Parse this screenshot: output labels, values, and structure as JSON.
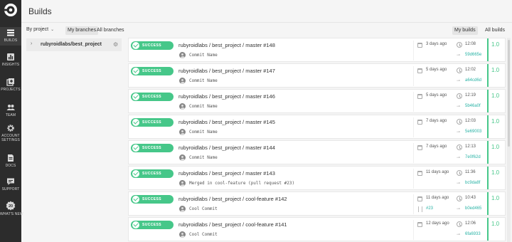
{
  "nav": {
    "logo": "circleci-logo",
    "items": [
      {
        "label": "BUILDS",
        "icon": "builds-icon"
      },
      {
        "label": "INSIGHTS",
        "icon": "insights-icon"
      },
      {
        "label": "PROJECTS",
        "icon": "projects-icon"
      },
      {
        "label": "TEAM",
        "icon": "team-icon"
      },
      {
        "label": "ACCOUNT",
        "label2": "SETTINGS",
        "icon": "gear-icon"
      },
      {
        "label": "DOCS",
        "icon": "docs-icon"
      },
      {
        "label": "SUPPORT",
        "icon": "support-icon"
      },
      {
        "label": "WHAT'S NEW",
        "icon": "whats-new-icon",
        "badge": "20"
      }
    ]
  },
  "header": {
    "title": "Builds"
  },
  "filters": {
    "by_project": "By project",
    "my_branches": "My branches",
    "all_branches": "All branches",
    "my_builds": "My builds",
    "all_builds": "All builds"
  },
  "project": {
    "name": "rubyroidlabs/best_project"
  },
  "colors": {
    "success": "#46c789",
    "link": "#2ab3a6",
    "nav_bg": "#2c2c2c"
  },
  "builds": [
    {
      "status": "SUCCESS",
      "title": "rubyroidlabs / best_project / master #148",
      "commit": "Commit Name",
      "ago": "3 days ago",
      "duration": "12:08",
      "sha": "59d665e",
      "version": "1.0",
      "pr": ""
    },
    {
      "status": "SUCCESS",
      "title": "rubyroidlabs / best_project / master #147",
      "commit": "Commit Name",
      "ago": "5 days ago",
      "duration": "12:02",
      "sha": "a64cd6d",
      "version": "1.0",
      "pr": ""
    },
    {
      "status": "SUCCESS",
      "title": "rubyroidlabs / best_project / master #146",
      "commit": "Commit Name",
      "ago": "5 days ago",
      "duration": "12:19",
      "sha": "5b46a0f",
      "version": "1.0",
      "pr": ""
    },
    {
      "status": "SUCCESS",
      "title": "rubyroidlabs / best_project / master #145",
      "commit": "Commit Name",
      "ago": "7 days ago",
      "duration": "12:03",
      "sha": "5e69003",
      "version": "1.0",
      "pr": ""
    },
    {
      "status": "SUCCESS",
      "title": "rubyroidlabs / best_project / master #144",
      "commit": "Commit Name",
      "ago": "7 days ago",
      "duration": "12:13",
      "sha": "7e0f62d",
      "version": "1.0",
      "pr": ""
    },
    {
      "status": "SUCCESS",
      "title": "rubyroidlabs / best_project / master #143",
      "commit": "Merged in cool-feature (pull request #23)",
      "ago": "11 days ago",
      "duration": "11:36",
      "sha": "bc9da8f",
      "version": "1.0",
      "pr": ""
    },
    {
      "status": "SUCCESS",
      "title": "rubyroidlabs / best_project / cool-feature #142",
      "commit": "Cool Commit",
      "ago": "11 days ago",
      "duration": "10:43",
      "sha": "b0ed465",
      "version": "1.0",
      "pr": "#23"
    },
    {
      "status": "SUCCESS",
      "title": "rubyroidlabs / best_project / cool-feature #141",
      "commit": "Cool Commit",
      "ago": "12 days ago",
      "duration": "12:06",
      "sha": "6fa6933",
      "version": "1.0",
      "pr": ""
    }
  ]
}
